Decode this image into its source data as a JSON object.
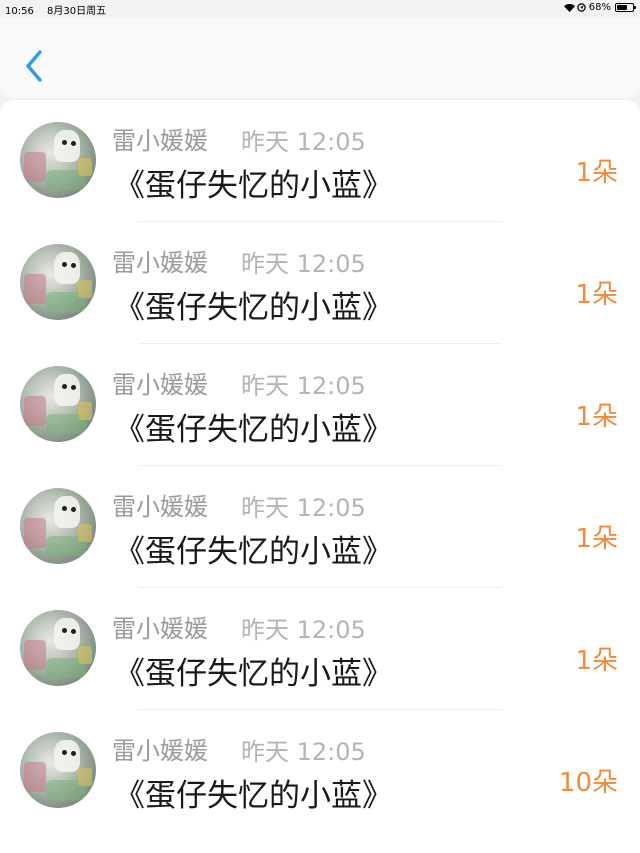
{
  "status_bar": {
    "time": "10:56",
    "date": "8月30日周五",
    "battery": "68%",
    "battery_level": 0.68,
    "icons": [
      "wifi-icon",
      "location-icon",
      "battery-icon"
    ]
  },
  "nav": {
    "back_icon": "chevron-left-icon",
    "accent_color": "#2f9bea"
  },
  "colors": {
    "count": "#f08a3c",
    "sender": "#9a9a9a",
    "time": "#b4b4b4",
    "title": "#1a1a1a"
  },
  "rows": [
    {
      "sender": "雷小媛媛",
      "time": "昨天 12:05",
      "title": "《蛋仔失忆的小蓝》",
      "count": "1朵"
    },
    {
      "sender": "雷小媛媛",
      "time": "昨天 12:05",
      "title": "《蛋仔失忆的小蓝》",
      "count": "1朵"
    },
    {
      "sender": "雷小媛媛",
      "time": "昨天 12:05",
      "title": "《蛋仔失忆的小蓝》",
      "count": "1朵"
    },
    {
      "sender": "雷小媛媛",
      "time": "昨天 12:05",
      "title": "《蛋仔失忆的小蓝》",
      "count": "1朵"
    },
    {
      "sender": "雷小媛媛",
      "time": "昨天 12:05",
      "title": "《蛋仔失忆的小蓝》",
      "count": "1朵"
    },
    {
      "sender": "雷小媛媛",
      "time": "昨天 12:05",
      "title": "《蛋仔失忆的小蓝》",
      "count": "10朵"
    }
  ]
}
